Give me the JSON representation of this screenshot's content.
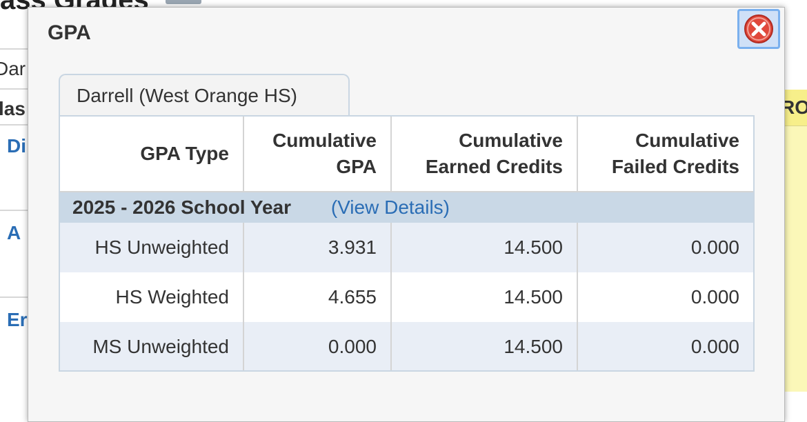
{
  "background": {
    "page_title": "ass Grades",
    "student_fragment": "Dar",
    "column_fragment": "las",
    "link_fragments": [
      "Di",
      "A",
      "Er"
    ],
    "right_header_fragment": "RO"
  },
  "dialog": {
    "title": "GPA",
    "close_icon": "close-x-icon",
    "tab_label": "Darrell (West Orange HS)",
    "columns": [
      "GPA Type",
      "Cumulative GPA",
      "Cumulative Earned Credits",
      "Cumulative Failed Credits"
    ],
    "column_lines": [
      [
        "GPA Type"
      ],
      [
        "Cumulative",
        "GPA"
      ],
      [
        "Cumulative",
        "Earned Credits"
      ],
      [
        "Cumulative",
        "Failed Credits"
      ]
    ],
    "year_label": "2025 - 2026 School Year",
    "view_details": "(View Details)",
    "rows": [
      {
        "type": "HS Unweighted",
        "gpa": "3.931",
        "earned": "14.500",
        "failed": "0.000"
      },
      {
        "type": "HS Weighted",
        "gpa": "4.655",
        "earned": "14.500",
        "failed": "0.000"
      },
      {
        "type": "MS Unweighted",
        "gpa": "0.000",
        "earned": "14.500",
        "failed": "0.000"
      }
    ]
  },
  "colors": {
    "link": "#2a6db5",
    "year_band": "#c9d8e6",
    "row_alt": "#e9eef6",
    "close_red": "#e0483b"
  }
}
